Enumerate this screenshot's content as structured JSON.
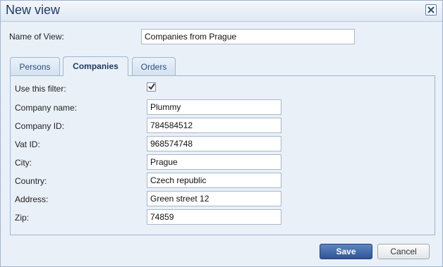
{
  "dialog": {
    "title": "New view",
    "close_icon": "close-icon"
  },
  "view_name": {
    "label": "Name of View:",
    "value": "Companies from Prague"
  },
  "tabs": [
    {
      "label": "Persons",
      "active": false
    },
    {
      "label": "Companies",
      "active": true
    },
    {
      "label": "Orders",
      "active": false
    }
  ],
  "filter": {
    "use_label": "Use this filter:",
    "use_checked": true
  },
  "fields": [
    {
      "label": "Company name:",
      "value": "Plummy"
    },
    {
      "label": "Company ID:",
      "value": "784584512"
    },
    {
      "label": "Vat ID:",
      "value": "968574748"
    },
    {
      "label": "City:",
      "value": "Prague"
    },
    {
      "label": "Country:",
      "value": "Czech republic"
    },
    {
      "label": "Address:",
      "value": "Green street 12"
    },
    {
      "label": "Zip:",
      "value": "74859"
    }
  ],
  "buttons": {
    "save": "Save",
    "cancel": "Cancel"
  },
  "colors": {
    "accent": "#2f5596",
    "title": "#1e3a66",
    "border": "#9fb6cf",
    "background": "#eaf0f8"
  }
}
